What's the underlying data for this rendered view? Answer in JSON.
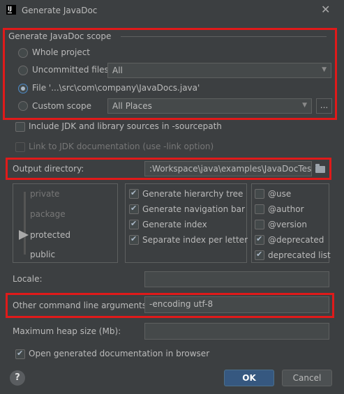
{
  "window": {
    "title": "Generate JavaDoc",
    "app_icon_text": "IJ"
  },
  "scope": {
    "group_title": "Generate JavaDoc scope",
    "whole_project": "Whole project",
    "uncommitted_files": "Uncommitted files",
    "uncommitted_combo": "All",
    "file": "File '...\\src\\com\\company\\JavaDocs.java'",
    "custom_scope": "Custom scope",
    "custom_combo": "All Places",
    "dots_button": "..."
  },
  "options": {
    "include_jdk": "Include JDK and library sources in -sourcepath",
    "link_jdk": "Link to JDK documentation (use -link option)"
  },
  "output": {
    "label": "Output directory:",
    "value": ":Workspace\\java\\examples\\JavaDocTest\\"
  },
  "visibility": {
    "levels": [
      "private",
      "package",
      "protected",
      "public"
    ],
    "selected": "protected"
  },
  "generate": {
    "hierarchy_tree": "Generate hierarchy tree",
    "navigation_bar": "Generate navigation bar",
    "index": "Generate index",
    "separate_index": "Separate index per letter"
  },
  "tags": {
    "use": "@use",
    "author": "@author",
    "version": "@version",
    "deprecated": "@deprecated",
    "deprecated_list": "deprecated list"
  },
  "locale": {
    "label": "Locale:",
    "value": ""
  },
  "other_args": {
    "label": "Other command line arguments:",
    "value": "-encoding utf-8"
  },
  "heap": {
    "label": "Maximum heap size (Mb):",
    "value": ""
  },
  "open_browser": "Open generated documentation in browser",
  "buttons": {
    "help": "?",
    "ok": "OK",
    "cancel": "Cancel"
  },
  "colors": {
    "background": "#3c3f41",
    "highlight": "#e01a1a",
    "ok_button": "#365880"
  }
}
